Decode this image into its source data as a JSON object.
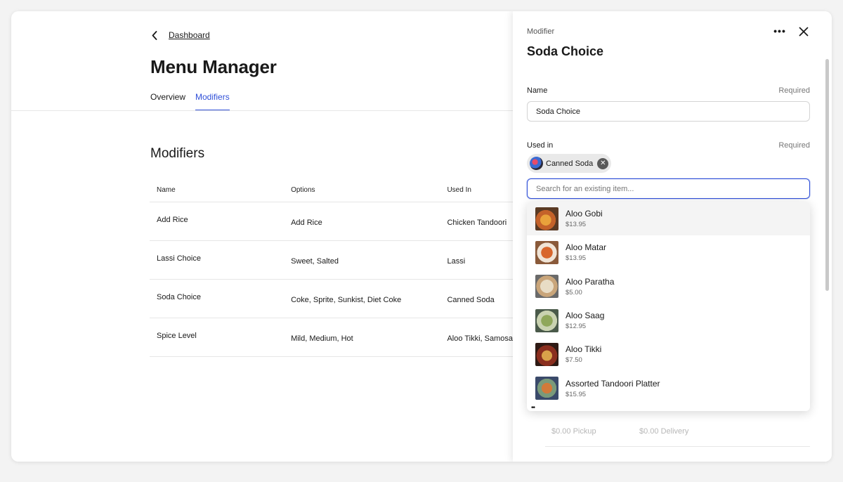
{
  "breadcrumb": {
    "label": "Dashboard"
  },
  "page": {
    "title": "Menu Manager"
  },
  "tabs": [
    {
      "label": "Overview",
      "active": false
    },
    {
      "label": "Modifiers",
      "active": true
    }
  ],
  "section": {
    "title": "Modifiers"
  },
  "table": {
    "columns": [
      "Name",
      "Options",
      "Used In"
    ],
    "rows": [
      {
        "name": "Add Rice",
        "options": "Add Rice",
        "used_in": "Chicken Tandoori"
      },
      {
        "name": "Lassi Choice",
        "options": "Sweet, Salted",
        "used_in": "Lassi"
      },
      {
        "name": "Soda Choice",
        "options": "Coke, Sprite, Sunkist, Diet Coke",
        "used_in": "Canned Soda"
      },
      {
        "name": "Spice Level",
        "options": "Mild, Medium, Hot",
        "used_in": "Aloo Tikki, Samosa"
      }
    ]
  },
  "panel": {
    "subtitle": "Modifier",
    "title": "Soda Choice",
    "more_label": "•••",
    "name_label": "Name",
    "name_required": "Required",
    "name_value": "Soda Choice",
    "used_in_label": "Used in",
    "used_in_required": "Required",
    "chip_label": "Canned Soda",
    "search_placeholder": "Search for an existing item...",
    "dropdown_items": [
      {
        "name": "Aloo Gobi",
        "price": "$13.95"
      },
      {
        "name": "Aloo Matar",
        "price": "$13.95"
      },
      {
        "name": "Aloo Paratha",
        "price": "$5.00"
      },
      {
        "name": "Aloo Saag",
        "price": "$12.95"
      },
      {
        "name": "Aloo Tikki",
        "price": "$7.50"
      },
      {
        "name": "Assorted Tandoori Platter",
        "price": "$15.95"
      }
    ],
    "pickup_price": "$0.00 Pickup",
    "delivery_price": "$0.00 Delivery"
  },
  "colors": {
    "accent": "#2f4fd8"
  },
  "icons": {
    "back": "chevron-left-icon",
    "more": "more-horizontal-icon",
    "close": "close-icon",
    "remove": "remove-chip-icon"
  }
}
